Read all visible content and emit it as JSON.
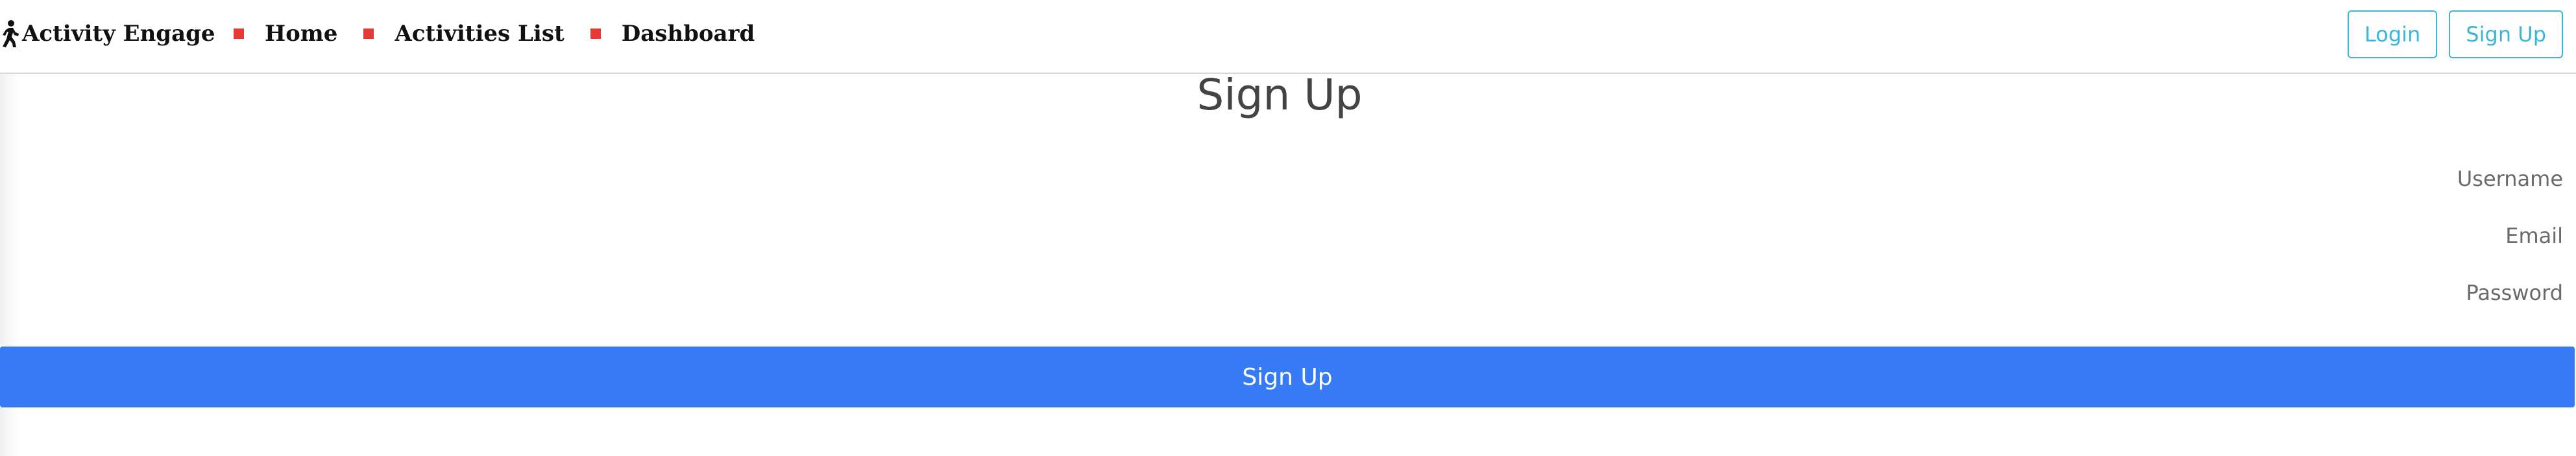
{
  "navbar": {
    "brand": {
      "icon": "person-walking-icon",
      "name": "Activity Engage"
    },
    "items": [
      {
        "label": "Home"
      },
      {
        "label": "Activities List"
      },
      {
        "label": "Dashboard"
      }
    ],
    "bullet_color": "#e53935",
    "login_label": "Login",
    "signup_label": "Sign Up"
  },
  "main": {
    "title": "Sign Up",
    "form": {
      "username_placeholder": "Username",
      "email_placeholder": "Email",
      "password_placeholder": "Password",
      "submit_label": "Sign Up"
    }
  },
  "colors": {
    "accent_outline": "#3ab7d8",
    "primary_button": "#367af6"
  }
}
